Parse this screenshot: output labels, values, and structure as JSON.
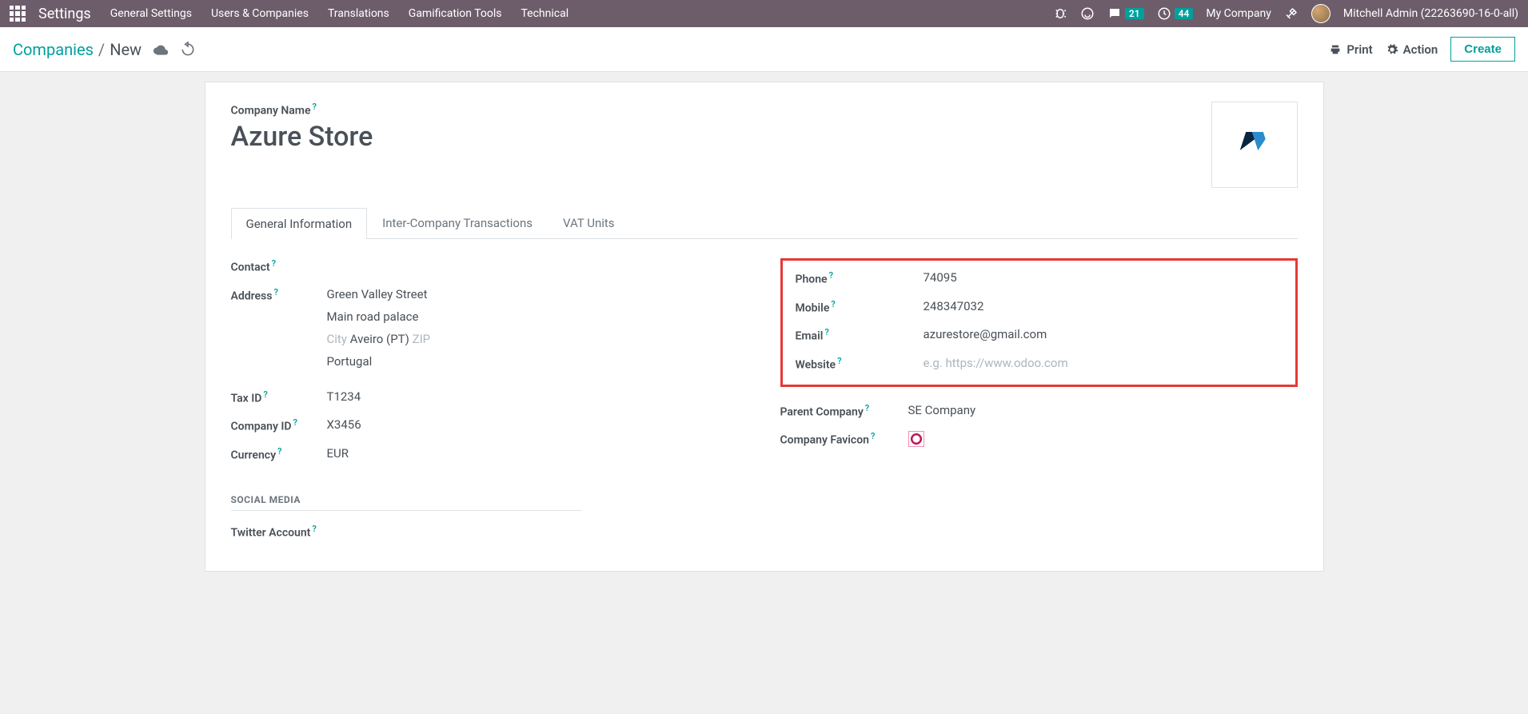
{
  "topbar": {
    "app_title": "Settings",
    "menu": [
      "General Settings",
      "Users & Companies",
      "Translations",
      "Gamification Tools",
      "Technical"
    ],
    "messages_badge": "21",
    "activities_badge": "44",
    "company": "My Company",
    "user": "Mitchell Admin (22263690-16-0-all)"
  },
  "headerbar": {
    "breadcrumb_root": "Companies",
    "breadcrumb_current": "New",
    "print": "Print",
    "action": "Action",
    "create": "Create"
  },
  "form": {
    "company_name_label": "Company Name",
    "company_name": "Azure Store",
    "tabs": [
      "General Information",
      "Inter-Company Transactions",
      "VAT Units"
    ],
    "left": {
      "contact_label": "Contact",
      "address_label": "Address",
      "street": "Green Valley Street",
      "street2": "Main road palace",
      "city_placeholder": "City",
      "state": "Aveiro (PT)",
      "zip_placeholder": "ZIP",
      "country": "Portugal",
      "tax_id_label": "Tax ID",
      "tax_id": "T1234",
      "company_id_label": "Company ID",
      "company_id": "X3456",
      "currency_label": "Currency",
      "currency": "EUR",
      "social_header": "SOCIAL MEDIA",
      "twitter_label": "Twitter Account"
    },
    "right": {
      "phone_label": "Phone",
      "phone": "74095",
      "mobile_label": "Mobile",
      "mobile": "248347032",
      "email_label": "Email",
      "email": "azurestore@gmail.com",
      "website_label": "Website",
      "website_placeholder": "e.g. https://www.odoo.com",
      "parent_label": "Parent Company",
      "parent": "SE Company",
      "favicon_label": "Company Favicon"
    }
  }
}
